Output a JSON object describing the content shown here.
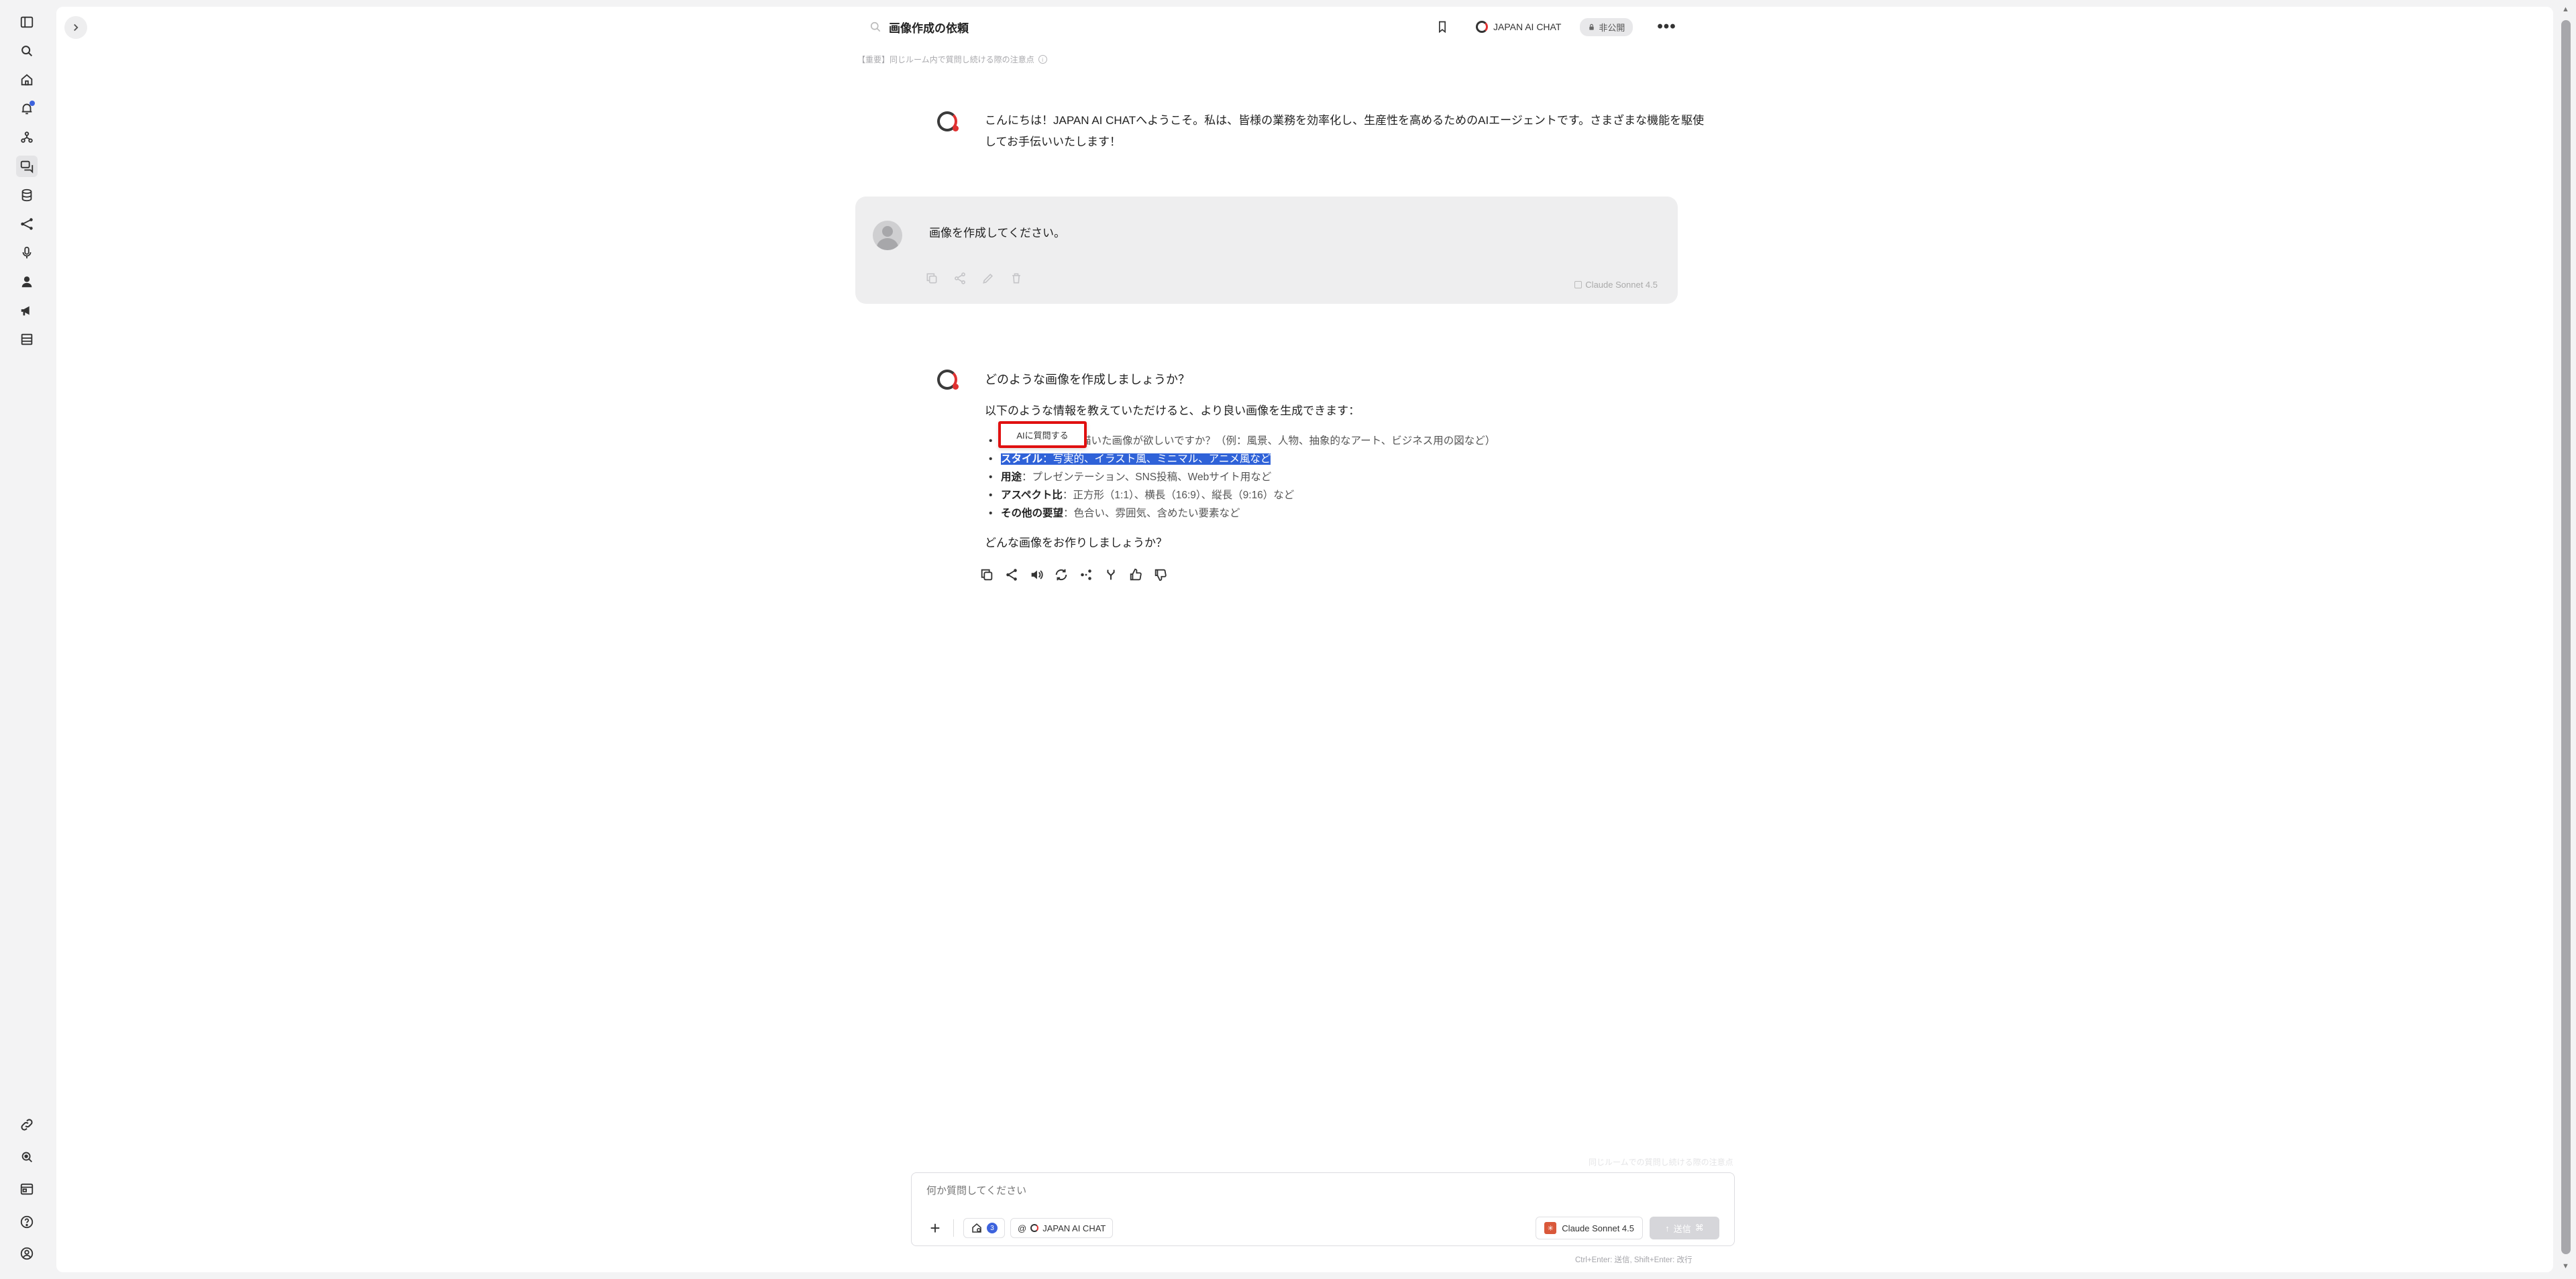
{
  "header": {
    "title": "画像作成の依頼",
    "agent_name": "JAPAN AI CHAT",
    "visibility": "非公開",
    "notice": "【重要】同じルーム内で質問し続ける際の注意点"
  },
  "sidebar": {
    "icons": [
      "sidebar-toggle-icon",
      "search-icon",
      "home-icon",
      "notification-icon",
      "agents-icon",
      "chat-icon",
      "database-icon",
      "workflow-icon",
      "microphone-icon",
      "person-icon",
      "megaphone-icon",
      "table-icon"
    ],
    "bottom_icons": [
      "link-icon",
      "search-doc-icon",
      "window-icon",
      "help-icon",
      "account-icon"
    ]
  },
  "messages": {
    "welcome": "こんにちは！JAPAN AI CHATへようこそ。私は、皆様の業務を効率化し、生産性を高めるためのAIエージェントです。さまざまな機能を駆使してお手伝いいたします！",
    "user": {
      "text": "画像を作成してください。",
      "model": "Claude Sonnet 4.5"
    },
    "reply": {
      "heading": "どのような画像を作成しましょうか？",
      "intro": "以下のような情報を教えていただけると、より良い画像を生成できます：",
      "bullets": [
        {
          "label": "",
          "prefix": "",
          "text": "何を描いた画像が欲しいですか？（例：風景、人物、抽象的なアート、ビジネス用の図など）"
        },
        {
          "label": "スタイル",
          "text": "：写実的、イラスト風、ミニマル、アニメ風など"
        },
        {
          "label": "用途",
          "text": "：プレゼンテーション、SNS投稿、Webサイト用など"
        },
        {
          "label": "アスペクト比",
          "text": "：正方形（1:1）、横長（16:9）、縦長（9:16）など"
        },
        {
          "label": "その他の要望",
          "text": "：色合い、雰囲気、含めたい要素など"
        }
      ],
      "outro": "どんな画像をお作りしましょうか？"
    }
  },
  "popup": {
    "ask_ai": "AIに質問する"
  },
  "composer": {
    "placeholder": "何か質問してください",
    "tool_count": "3",
    "agent_chip": "JAPAN AI CHAT",
    "model": "Claude Sonnet 4.5",
    "send_label": "送信",
    "ghost_hint": "同じルームでの質問し続ける際の注意点",
    "shortcut_hint": "Ctrl+Enter: 送信, Shift+Enter: 改行"
  },
  "colors": {
    "selection": "#2f62d8",
    "highlight_border": "#e01010",
    "accent": "#3d63dd"
  }
}
